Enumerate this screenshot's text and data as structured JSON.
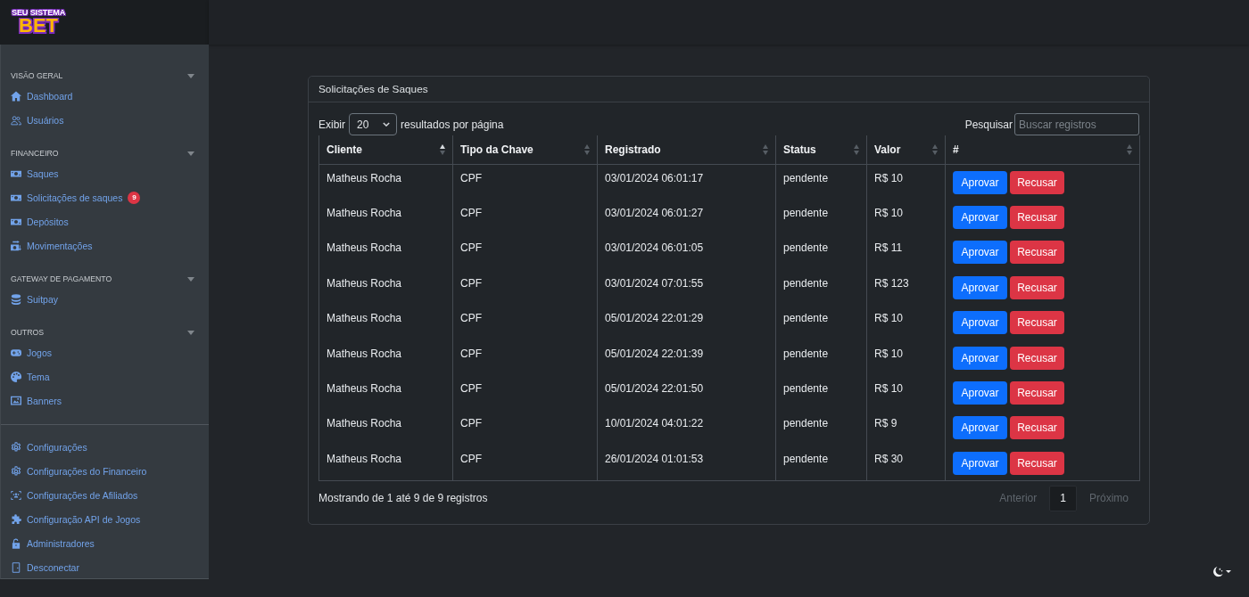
{
  "brand": {
    "line_1": "SEU SISTEMA",
    "line_2": "BET"
  },
  "sidebar": {
    "sections": [
      {
        "title": "VISÃO GERAL",
        "expanded": true,
        "items": [
          {
            "label": "Dashboard"
          },
          {
            "label": "Usuários"
          }
        ]
      },
      {
        "title": "FINANCEIRO",
        "expanded": true,
        "items": [
          {
            "label": "Saques"
          },
          {
            "label": "Solicitações de saques",
            "badge": "9"
          },
          {
            "label": "Depósitos"
          },
          {
            "label": "Movimentações"
          }
        ]
      },
      {
        "title": "GATEWAY DE PAGAMENTO",
        "expanded": true,
        "items": [
          {
            "label": "Suitpay"
          }
        ]
      },
      {
        "title": "OUTROS",
        "expanded": true,
        "items": [
          {
            "label": "Jogos"
          },
          {
            "label": "Tema"
          },
          {
            "label": "Banners"
          }
        ]
      }
    ],
    "footer_items": [
      {
        "label": "Configurações"
      },
      {
        "label": "Configurações do Financeiro"
      },
      {
        "label": "Configurações de Afiliados"
      },
      {
        "label": "Configuração API de Jogos"
      },
      {
        "label": "Administradores"
      },
      {
        "label": "Desconectar"
      }
    ]
  },
  "card": {
    "title": "Solicitações de Saques"
  },
  "length_menu": {
    "label_before": "Exibir",
    "value": "20",
    "label_after": "resultados por página"
  },
  "search": {
    "label": "Pesquisar",
    "placeholder": "Buscar registros"
  },
  "table": {
    "columns": [
      {
        "label": "Cliente",
        "sorted": true
      },
      {
        "label": "Tipo da Chave",
        "sorted": false
      },
      {
        "label": "Registrado",
        "sorted": false
      },
      {
        "label": "Status",
        "sorted": false
      },
      {
        "label": "Valor",
        "sorted": false
      },
      {
        "label": "#",
        "sorted": false
      }
    ],
    "rows": [
      {
        "cells": [
          "Matheus Rocha",
          "CPF",
          "03/01/2024 06:01:17",
          "pendente",
          "R$ 10"
        ],
        "actions": [
          {
            "label": "Aprovar",
            "kind": "approve"
          },
          {
            "label": "Recusar",
            "kind": "reject"
          }
        ]
      },
      {
        "cells": [
          "Matheus Rocha",
          "CPF",
          "03/01/2024 06:01:27",
          "pendente",
          "R$ 10"
        ],
        "actions": [
          {
            "label": "Aprovar",
            "kind": "approve"
          },
          {
            "label": "Recusar",
            "kind": "reject"
          }
        ]
      },
      {
        "cells": [
          "Matheus Rocha",
          "CPF",
          "03/01/2024 06:01:05",
          "pendente",
          "R$ 11"
        ],
        "actions": [
          {
            "label": "Aprovar",
            "kind": "approve"
          },
          {
            "label": "Recusar",
            "kind": "reject"
          }
        ]
      },
      {
        "cells": [
          "Matheus Rocha",
          "CPF",
          "03/01/2024 07:01:55",
          "pendente",
          "R$ 123"
        ],
        "actions": [
          {
            "label": "Aprovar",
            "kind": "approve"
          },
          {
            "label": "Recusar",
            "kind": "reject"
          }
        ]
      },
      {
        "cells": [
          "Matheus Rocha",
          "CPF",
          "05/01/2024 22:01:29",
          "pendente",
          "R$ 10"
        ],
        "actions": [
          {
            "label": "Aprovar",
            "kind": "approve"
          },
          {
            "label": "Recusar",
            "kind": "reject"
          }
        ]
      },
      {
        "cells": [
          "Matheus Rocha",
          "CPF",
          "05/01/2024 22:01:39",
          "pendente",
          "R$ 10"
        ],
        "actions": [
          {
            "label": "Aprovar",
            "kind": "approve"
          },
          {
            "label": "Recusar",
            "kind": "reject"
          }
        ]
      },
      {
        "cells": [
          "Matheus Rocha",
          "CPF",
          "05/01/2024 22:01:50",
          "pendente",
          "R$ 10"
        ],
        "actions": [
          {
            "label": "Aprovar",
            "kind": "approve"
          },
          {
            "label": "Recusar",
            "kind": "reject"
          }
        ]
      },
      {
        "cells": [
          "Matheus Rocha",
          "CPF",
          "10/01/2024 04:01:22",
          "pendente",
          "R$ 9"
        ],
        "actions": [
          {
            "label": "Aprovar",
            "kind": "approve"
          },
          {
            "label": "Recusar",
            "kind": "reject"
          }
        ]
      },
      {
        "cells": [
          "Matheus Rocha",
          "CPF",
          "26/01/2024 01:01:53",
          "pendente",
          "R$ 30"
        ],
        "actions": [
          {
            "label": "Aprovar",
            "kind": "approve"
          },
          {
            "label": "Recusar",
            "kind": "reject"
          }
        ]
      }
    ]
  },
  "info": "Mostrando de 1 até 9 de 9 registros",
  "pagination": {
    "previous": {
      "label": "Anterior",
      "disabled": true
    },
    "pages": [
      {
        "label": "1",
        "selected": true
      }
    ],
    "next": {
      "label": "Próximo",
      "disabled": true
    }
  }
}
